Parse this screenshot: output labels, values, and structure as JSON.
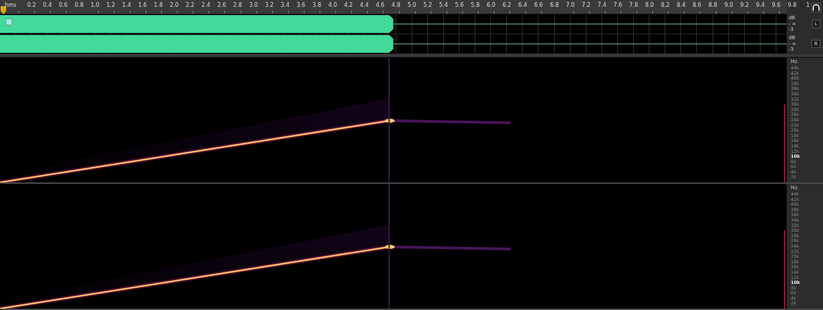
{
  "ruler": {
    "unit": "hms",
    "labels": [
      "0.2",
      "0.4",
      "0.6",
      "0.8",
      "1.0",
      "1.2",
      "1.4",
      "1.6",
      "1.8",
      "2.0",
      "2.2",
      "2.4",
      "2.6",
      "2.8",
      "3.0",
      "3.2",
      "3.4",
      "3.6",
      "3.8",
      "4.0",
      "4.2",
      "4.4",
      "4.6",
      "4.8",
      "5.0",
      "5.2",
      "5.4",
      "5.6",
      "5.8",
      "6.0",
      "6.2",
      "6.4",
      "6.6",
      "6.8",
      "7.0",
      "7.2",
      "7.4",
      "7.6",
      "7.8",
      "8.0",
      "8.2",
      "8.4",
      "8.6",
      "8.8",
      "9.0",
      "9.2",
      "9.4",
      "9.6",
      "9.8",
      "1"
    ]
  },
  "tracks": [
    {
      "channel": "L",
      "db_labels": [
        "dB",
        "- ∞",
        "-3"
      ]
    },
    {
      "channel": "R",
      "db_labels": [
        "dB",
        "- ∞",
        "-3"
      ]
    }
  ],
  "spectrograms": [
    {
      "unit": "Hz",
      "labels": [
        {
          "text": "44k",
          "emphasized": false
        },
        {
          "text": "42k",
          "emphasized": false
        },
        {
          "text": "40k",
          "emphasized": false
        },
        {
          "text": "38k",
          "emphasized": false
        },
        {
          "text": "36k",
          "emphasized": false
        },
        {
          "text": "34k",
          "emphasized": false
        },
        {
          "text": "32k",
          "emphasized": false
        },
        {
          "text": "30k",
          "emphasized": false
        },
        {
          "text": "28k",
          "emphasized": false
        },
        {
          "text": "26k",
          "emphasized": false
        },
        {
          "text": "24k",
          "emphasized": false
        },
        {
          "text": "22k",
          "emphasized": false
        },
        {
          "text": "20k",
          "emphasized": false
        },
        {
          "text": "18k",
          "emphasized": false
        },
        {
          "text": "16k",
          "emphasized": false
        },
        {
          "text": "14k",
          "emphasized": false
        },
        {
          "text": "12k",
          "emphasized": false
        },
        {
          "text": "10k",
          "emphasized": true
        },
        {
          "text": "8k",
          "emphasized": false
        },
        {
          "text": "6k",
          "emphasized": false
        },
        {
          "text": "4k",
          "emphasized": false
        },
        {
          "text": "2k",
          "emphasized": false
        }
      ]
    },
    {
      "unit": "Hz",
      "labels": [
        {
          "text": "44k",
          "emphasized": false
        },
        {
          "text": "42k",
          "emphasized": false
        },
        {
          "text": "40k",
          "emphasized": false
        },
        {
          "text": "38k",
          "emphasized": false
        },
        {
          "text": "36k",
          "emphasized": false
        },
        {
          "text": "34k",
          "emphasized": false
        },
        {
          "text": "32k",
          "emphasized": false
        },
        {
          "text": "30k",
          "emphasized": false
        },
        {
          "text": "28k",
          "emphasized": false
        },
        {
          "text": "26k",
          "emphasized": false
        },
        {
          "text": "24k",
          "emphasized": false
        },
        {
          "text": "22k",
          "emphasized": false
        },
        {
          "text": "20k",
          "emphasized": false
        },
        {
          "text": "18k",
          "emphasized": false
        },
        {
          "text": "16k",
          "emphasized": false
        },
        {
          "text": "14k",
          "emphasized": false
        },
        {
          "text": "12k",
          "emphasized": false
        },
        {
          "text": "10k",
          "emphasized": true
        },
        {
          "text": "8k",
          "emphasized": false
        },
        {
          "text": "6k",
          "emphasized": false
        },
        {
          "text": "4k",
          "emphasized": false
        },
        {
          "text": "2k",
          "emphasized": false
        }
      ]
    }
  ]
}
